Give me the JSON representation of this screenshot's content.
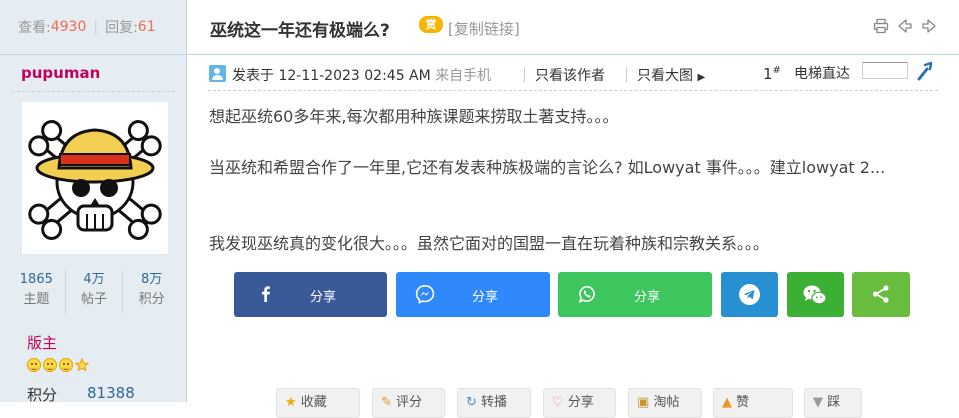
{
  "sidebar": {
    "views_label": "查看:",
    "views": "4930",
    "replies_label": "回复:",
    "replies": "61",
    "username": "pupuman",
    "stats": [
      {
        "value": "1865",
        "label": "主题"
      },
      {
        "value": "4万",
        "label": "帖子"
      },
      {
        "value": "8万",
        "label": "积分"
      }
    ],
    "rank": "版主",
    "credit_label": "积分",
    "credit_value": "81388"
  },
  "thread": {
    "title": "巫统这一年还有极端么?",
    "copy_link": "[复制链接]",
    "reward_badge": "赏"
  },
  "post": {
    "posted_prefix": "发表于",
    "posted_time": "12-11-2023 02:45 AM",
    "posted_from": "来自手机",
    "view_author": "只看该作者",
    "view_big": "只看大图",
    "floor": "1",
    "floor_sup": "#",
    "jump_label": "电梯直达",
    "body": [
      "想起巫统60多年来,每次都用种族课题来捞取土著支持。。。",
      "当巫统和希盟合作了一年里,它还有发表种族极端的言论么? 如Lowyat 事件。。。建立lowyat 2...",
      "我发现巫统真的变化很大。。。虽然它面对的国盟一直在玩着种族和宗教关系。。。"
    ]
  },
  "share": {
    "facebook": "分享",
    "messenger": "分享",
    "whatsapp": "分享",
    "colors": {
      "facebook": "#3a5998",
      "messenger": "#2f89fc",
      "whatsapp": "#3dc55e",
      "telegram": "#2690d2",
      "wechat": "#3cb035",
      "more": "#69bd3e"
    }
  },
  "actions": [
    "收藏",
    "评分",
    "转播",
    "分享",
    "淘帖",
    "赞",
    "踩"
  ],
  "colors": {
    "sidebar_bg": "#e5edf2",
    "username": "#c2015c",
    "link_blue": "#336699",
    "count_orange": "#f26c4f"
  }
}
